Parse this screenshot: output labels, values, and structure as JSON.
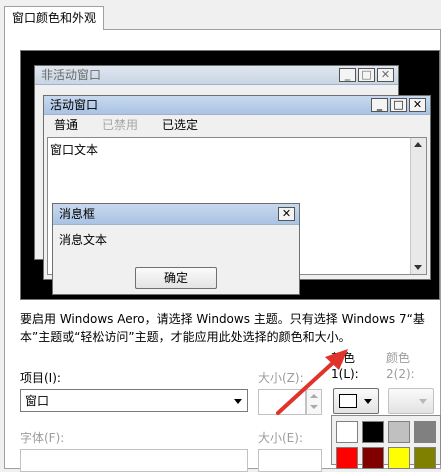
{
  "tabs": [
    {
      "label": "窗口颜色和外观"
    }
  ],
  "preview": {
    "inactive_window": {
      "title": "非活动窗口"
    },
    "active_window": {
      "title": "活动窗口",
      "menu": [
        {
          "label": "普通",
          "state": "normal"
        },
        {
          "label": "已禁用",
          "state": "disabled"
        },
        {
          "label": "已选定",
          "state": "selected"
        }
      ],
      "body_text": "窗口文本"
    },
    "message_box": {
      "title": "消息框",
      "text": "消息文本",
      "ok_label": "确定"
    }
  },
  "info_text_line1": "要启用 Windows Aero，请选择 Windows 主题。只有选择 Windows 7“基",
  "info_text_line2": "本”主题或“轻松访问”主题，才能应用此处选择的颜色和大小。",
  "form": {
    "item_label": "项目(I):",
    "item_value": "窗口",
    "size_label": "大小(Z):",
    "color1_label_line1": "颜色",
    "color1_label_line2": "1(L):",
    "color2_label_line1": "颜色",
    "color2_label_line2": "2(2):",
    "font_label": "字体(F):",
    "font_size_label": "大小(E):"
  },
  "colors": {
    "accent_arrow": "#e0332b",
    "palette": [
      "#ffffff",
      "#000000",
      "#c0c0c0",
      "#808080",
      "#ff0000",
      "#800000",
      "#ffff00",
      "#808000"
    ]
  }
}
